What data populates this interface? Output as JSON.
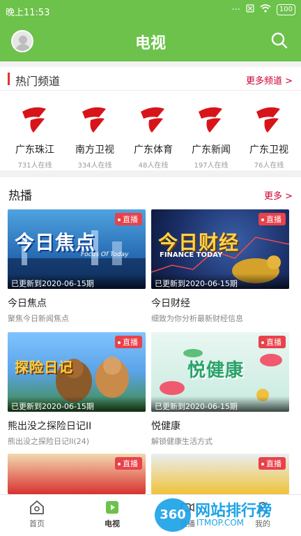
{
  "status_bar": {
    "time": "晚上11:53",
    "icons": [
      "dots-icon",
      "sim-icon",
      "wifi-icon"
    ],
    "battery": "100"
  },
  "header": {
    "title": "电视"
  },
  "hot_channels": {
    "title": "热门频道",
    "more": "更多频道 >",
    "channels": [
      {
        "name": "广东珠江",
        "online": "731人在线"
      },
      {
        "name": "南方卫视",
        "online": "334人在线"
      },
      {
        "name": "广东体育",
        "online": "48人在线"
      },
      {
        "name": "广东新闻",
        "online": "197人在线"
      },
      {
        "name": "广东卫视",
        "online": "76人在线"
      }
    ]
  },
  "hot_broadcast": {
    "title": "热播",
    "more": "更多 >",
    "badge": "直播",
    "items": [
      {
        "thumb_title": "今日焦点",
        "thumb_sub": "Focus Of Today",
        "updated": "已更新到2020-06-15期",
        "title": "今日焦点",
        "subtitle": "聚焦今日新闻焦点"
      },
      {
        "thumb_title": "今日财经",
        "thumb_sub": "FINANCE TODAY",
        "updated": "已更新到2020-06-15期",
        "title": "今日财经",
        "subtitle": "细致为你分析最新财经信息"
      },
      {
        "thumb_title": "探险日记",
        "thumb_sub": "",
        "updated": "已更新到2020-06-15期",
        "title": "熊出没之探险日记II",
        "subtitle": "熊出没之探险日记II(24)"
      },
      {
        "thumb_title": "悦健康",
        "thumb_sub": "",
        "updated": "已更新到2020-06-15期",
        "title": "悦健康",
        "subtitle": "解锁健康生活方式"
      }
    ]
  },
  "bottom_nav": {
    "tabs": [
      {
        "label": "首页",
        "icon": "home-icon"
      },
      {
        "label": "电视",
        "icon": "tv-play-icon",
        "active": true
      },
      {
        "label": "直播",
        "icon": "camera-icon"
      },
      {
        "label": "我的",
        "icon": "user-icon"
      }
    ]
  },
  "watermark": {
    "logo": "360",
    "text": "网站排行榜",
    "sub": "ITMOP.COM",
    "url": "WANGZHANPAIHANG"
  },
  "colors": {
    "primary_green": "#6cc24a",
    "accent_red": "#cc0033",
    "badge_red": "#e8424a"
  }
}
